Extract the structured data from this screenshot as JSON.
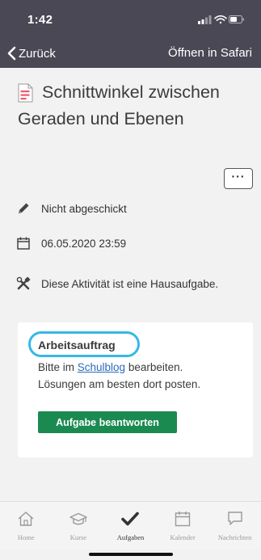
{
  "status": {
    "time": "1:42"
  },
  "nav": {
    "back_label": "Zurück",
    "open_safari": "Öffnen in Safari"
  },
  "assignment": {
    "title": "Schnittwinkel zwischen Geraden und Ebenen",
    "more_label": "···",
    "status": "Nicht abgeschickt",
    "due": "06.05.2020 23:59",
    "homework_note": "Diese Aktivität ist eine Hausaufgabe."
  },
  "card": {
    "title": "Arbeitsauftrag",
    "line1_prefix": "Bitte im ",
    "line1_link": "Schulblog",
    "line1_suffix": " bearbeiten.",
    "line2": "Lösungen am besten dort posten.",
    "button": "Aufgabe beantworten"
  },
  "tabs": [
    {
      "label": "Home",
      "icon": "home-icon"
    },
    {
      "label": "Kurse",
      "icon": "graduation-cap-icon"
    },
    {
      "label": "Aufgaben",
      "icon": "checkmark-icon"
    },
    {
      "label": "Kalender",
      "icon": "calendar-icon"
    },
    {
      "label": "Nachrichten",
      "icon": "speech-bubble-icon"
    }
  ],
  "colors": {
    "header": "#4a4855",
    "accent_green": "#1b8a50",
    "highlight_blue": "#36b8e6",
    "link": "#2b6bbf"
  }
}
